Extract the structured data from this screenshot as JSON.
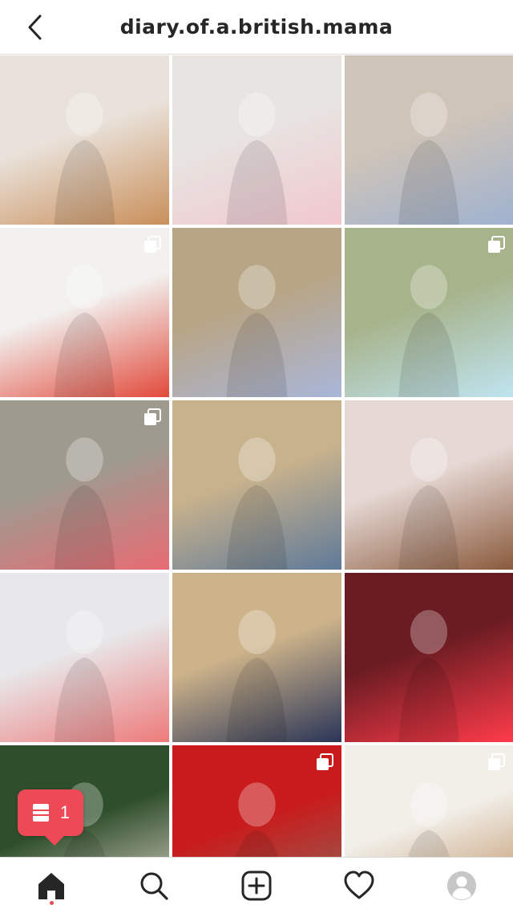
{
  "header": {
    "username": "diary.of.a.british.mama",
    "back_icon": "chevron-left-icon"
  },
  "posts": [
    {
      "name": "post-girl-smiling-floral-dress",
      "colors": [
        "#e9e2da",
        "#c98f5a"
      ],
      "multi": false
    },
    {
      "name": "post-mother-holding-baby",
      "colors": [
        "#e8e4e1",
        "#f0c7cf"
      ],
      "multi": false
    },
    {
      "name": "post-girl-on-sand",
      "colors": [
        "#cfc4b8",
        "#9fb2cf"
      ],
      "multi": false
    },
    {
      "name": "post-girl-doctor-costume",
      "colors": [
        "#f2f1ef",
        "#e24a3b"
      ],
      "multi": true
    },
    {
      "name": "post-girl-in-woods",
      "colors": [
        "#b8a586",
        "#a9b6d9"
      ],
      "multi": false
    },
    {
      "name": "post-girl-fairy-wings",
      "colors": [
        "#a7b38a",
        "#bfe4f0"
      ],
      "multi": true
    },
    {
      "name": "post-girl-in-puddle",
      "colors": [
        "#9f9a8f",
        "#e86b73"
      ],
      "multi": true
    },
    {
      "name": "post-girl-lying-on-grass",
      "colors": [
        "#c8b28c",
        "#5f7a99"
      ],
      "multi": false
    },
    {
      "name": "post-girl-braided-hair",
      "colors": [
        "#e6d9d5",
        "#8a5a3c"
      ],
      "multi": false
    },
    {
      "name": "post-girl-in-snow",
      "colors": [
        "#e8e8ea",
        "#ee7a7a"
      ],
      "multi": false
    },
    {
      "name": "post-siblings-holding-hands",
      "colors": [
        "#cdb38a",
        "#2a3557"
      ],
      "multi": false
    },
    {
      "name": "post-nutcracker-lights",
      "colors": [
        "#6b1c22",
        "#ff3b4a"
      ],
      "multi": false
    },
    {
      "name": "post-girl-christmas-tree",
      "colors": [
        "#2f4f2c",
        "#eadbd2"
      ],
      "multi": false
    },
    {
      "name": "post-red-post-box",
      "colors": [
        "#c91b1b",
        "#8a6b5e"
      ],
      "multi": true
    },
    {
      "name": "post-shape-puzzle-game",
      "colors": [
        "#f2efe9",
        "#b98a5a"
      ],
      "multi": true
    }
  ],
  "notification": {
    "count": "1",
    "icon": "post-stack-icon"
  },
  "nav": [
    {
      "name": "nav-home",
      "icon": "home-icon",
      "active": true
    },
    {
      "name": "nav-search",
      "icon": "search-icon",
      "active": false
    },
    {
      "name": "nav-create",
      "icon": "add-post-icon",
      "active": false
    },
    {
      "name": "nav-activity",
      "icon": "heart-icon",
      "active": false
    },
    {
      "name": "nav-profile",
      "icon": "avatar-icon",
      "active": false
    }
  ],
  "colors": {
    "accent": "#ed4956",
    "text": "#262626",
    "divider": "#dbdbdb"
  }
}
